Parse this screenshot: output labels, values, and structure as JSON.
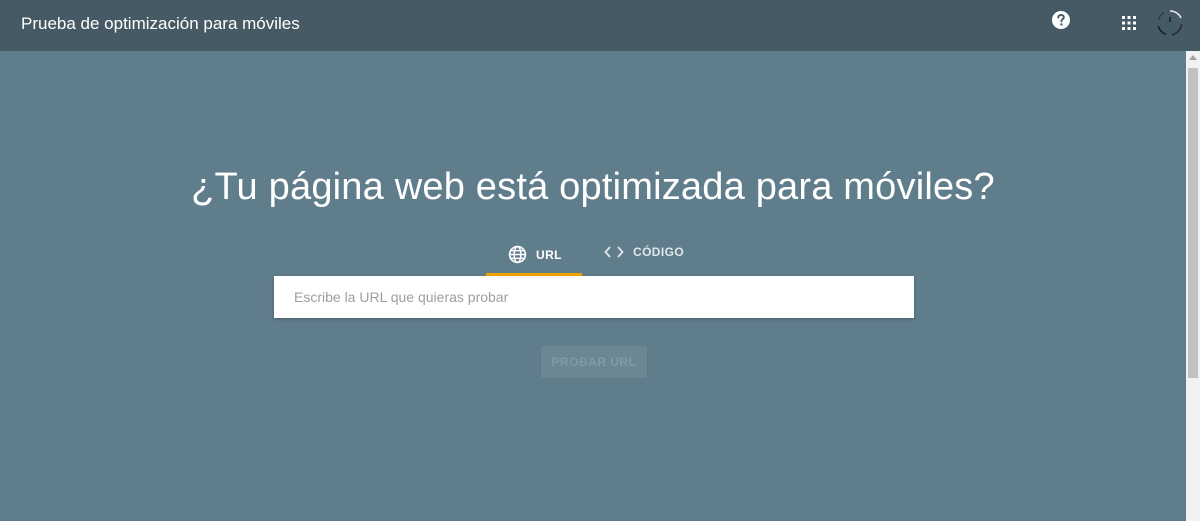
{
  "header": {
    "title": "Prueba de optimización para móviles",
    "icons": [
      "help-icon",
      "apps-grid-icon",
      "avatar-loading-icon"
    ]
  },
  "main": {
    "heading": "¿Tu página web está optimizada para móviles?",
    "tabs": [
      {
        "label": "URL",
        "icon": "globe-icon",
        "selected": true
      },
      {
        "label": "CÓDIGO",
        "icon": "code-icon",
        "selected": false
      }
    ],
    "url_input": {
      "placeholder": "Escribe la URL que quieras probar",
      "value": ""
    },
    "test_button": {
      "label": "PROBAR URL",
      "disabled": true
    }
  },
  "colors": {
    "header_bg": "#455a64",
    "page_bg": "#607d8b",
    "tab_indicator": "#f4a300",
    "input_bg": "#ffffff"
  }
}
